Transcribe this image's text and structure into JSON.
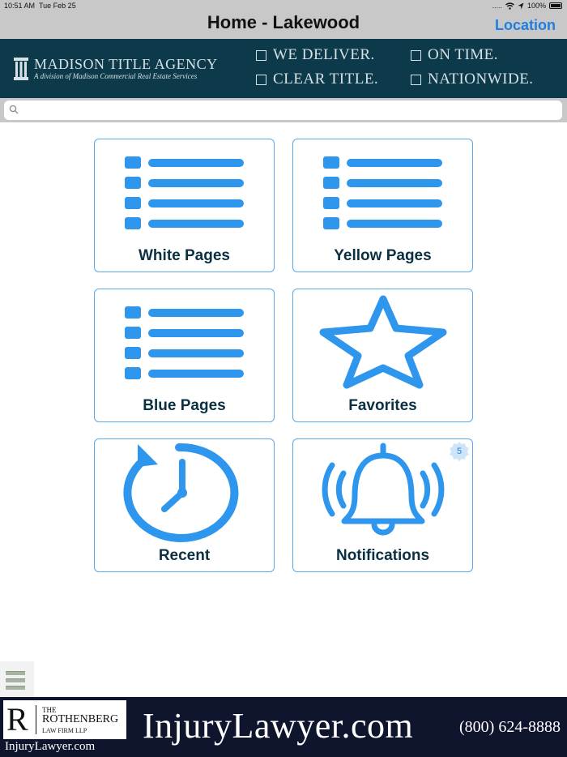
{
  "status_bar": {
    "time": "10:51 AM",
    "date": "Tue Feb 25",
    "signal": ".....",
    "battery": "100%"
  },
  "nav": {
    "title": "Home - Lakewood",
    "location_button": "Location"
  },
  "top_banner": {
    "brand": "MADISON TITLE AGENCY",
    "tagline": "A division of Madison Commercial Real Estate Services",
    "claims": [
      "WE DELIVER.",
      "ON TIME.",
      "CLEAR TITLE.",
      "NATIONWIDE."
    ],
    "background_color": "#0c3a4a"
  },
  "search": {
    "placeholder": "",
    "value": ""
  },
  "tiles": [
    {
      "label": "White Pages",
      "icon": "list-icon"
    },
    {
      "label": "Yellow Pages",
      "icon": "list-icon"
    },
    {
      "label": "Blue Pages",
      "icon": "list-icon"
    },
    {
      "label": "Favorites",
      "icon": "star-icon"
    },
    {
      "label": "Recent",
      "icon": "history-clock-icon"
    },
    {
      "label": "Notifications",
      "icon": "bell-ringing-icon",
      "badge": "5"
    }
  ],
  "accent_color": "#2e96ec",
  "side_menu": {
    "icon": "hamburger-menu-icon"
  },
  "bottom_banner": {
    "firm_initial": "R",
    "firm_the": "THE",
    "firm_name": "ROTHENBERG",
    "firm_suffix": "LAW FIRM LLP",
    "firm_site": "InjuryLawyer.com",
    "headline_domain": "InjuryLawyer.com",
    "phone": "(800) 624-8888"
  }
}
